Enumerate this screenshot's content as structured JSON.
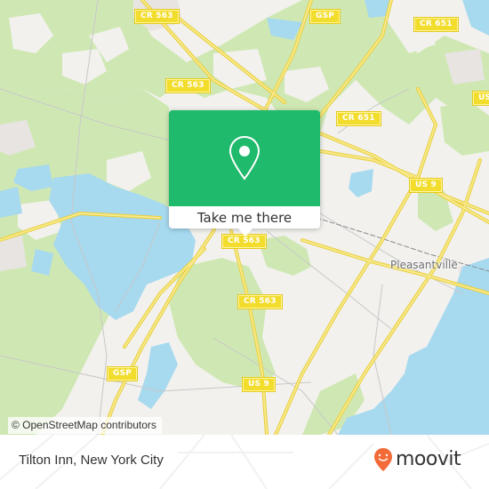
{
  "map": {
    "colors": {
      "land": "#f2f1ee",
      "forest": "#cfe8b3",
      "water": "#a7d9ef",
      "urban": "#e8e4e1",
      "road_major": "#f5e05a",
      "road_minor": "#c8c8c8",
      "railway": "#8a8a8a"
    },
    "road_shields": [
      {
        "id": "cr563-top",
        "label": "CR 563"
      },
      {
        "id": "gsp-top",
        "label": "GSP"
      },
      {
        "id": "cr651-top",
        "label": "CR 651"
      },
      {
        "id": "cr563-mid",
        "label": "CR 563"
      },
      {
        "id": "us-right",
        "label": "US"
      },
      {
        "id": "cr651-mid",
        "label": "CR 651"
      },
      {
        "id": "us9-mid",
        "label": "US 9"
      },
      {
        "id": "cr563-lower",
        "label": "CR 563"
      },
      {
        "id": "cr563-south",
        "label": "CR 563"
      },
      {
        "id": "gsp-bottom",
        "label": "GSP"
      },
      {
        "id": "us9-bottom",
        "label": "US 9"
      }
    ],
    "place_labels": [
      {
        "id": "pleasantville",
        "label": "Pleasantville"
      }
    ],
    "attribution": "© OpenStreetMap contributors"
  },
  "popup": {
    "icon": "map-pin-icon",
    "button_label": "Take me there",
    "color": "#1fba6b"
  },
  "footer": {
    "place_name": "Tilton Inn, New York City",
    "brand": "moovit",
    "brand_color": "#f26b38"
  }
}
